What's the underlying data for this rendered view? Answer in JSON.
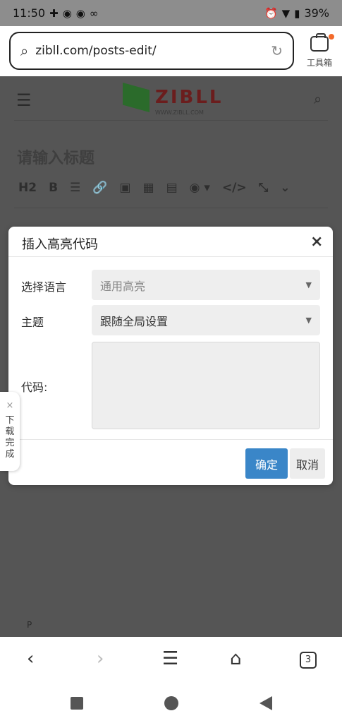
{
  "status_bar": {
    "time": "11:50",
    "left_icons": [
      "health-icon",
      "q-icon",
      "q-icon",
      "link-icon"
    ],
    "battery": "39%"
  },
  "address_bar": {
    "url": "zibll.com/posts-edit/",
    "toolbox_label": "工具箱"
  },
  "page": {
    "logo_text": "ZIBLL",
    "logo_sub": "WWW.ZIBLL.COM",
    "title_placeholder": "请输入标题",
    "toolbar": [
      "H2",
      "B",
      "☰",
      "🔗",
      "▣",
      "▦",
      "▤",
      "◉ ▾",
      "</>",
      "⤡",
      "⌄"
    ],
    "footer_tag": "P"
  },
  "modal": {
    "title": "插入高亮代码",
    "close": "×",
    "language_label": "选择语言",
    "language_value": "通用高亮",
    "theme_label": "主题",
    "theme_value": "跟随全局设置",
    "code_label": "代码:",
    "code_value": "",
    "ok": "确定",
    "cancel": "取消"
  },
  "toast": {
    "close": "×",
    "text": "下载完成"
  },
  "browser_nav": {
    "tabs_count": "3"
  }
}
